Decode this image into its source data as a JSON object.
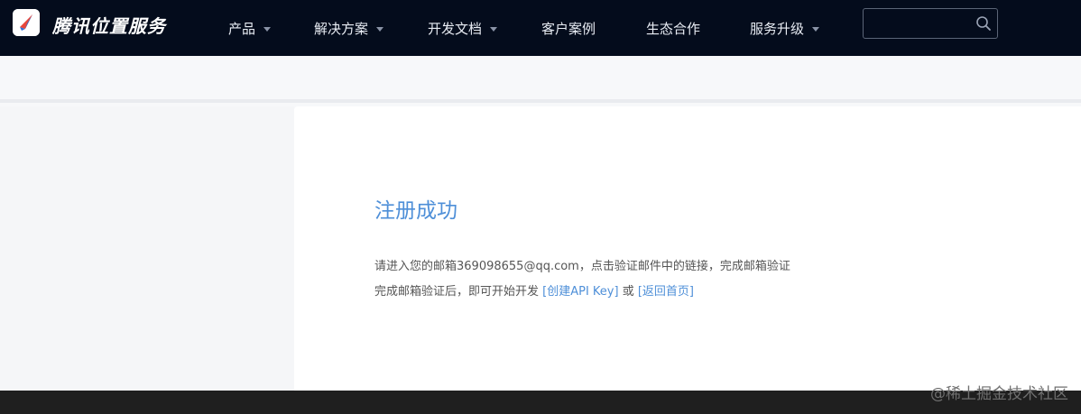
{
  "header": {
    "brand": "腾讯位置服务",
    "nav": [
      {
        "label": "产品",
        "has_dropdown": true
      },
      {
        "label": "解决方案",
        "has_dropdown": true
      },
      {
        "label": "开发文档",
        "has_dropdown": true
      },
      {
        "label": "客户案例",
        "has_dropdown": false
      },
      {
        "label": "生态合作",
        "has_dropdown": false
      },
      {
        "label": "服务升级",
        "has_dropdown": true
      }
    ],
    "search": {
      "value": "",
      "placeholder": "",
      "icon": "search-icon"
    }
  },
  "main": {
    "title": "注册成功",
    "line1": "请进入您的邮箱369098655@qq.com，点击验证邮件中的链接，完成邮箱验证",
    "line2_prefix": "完成邮箱验证后，即可开始开发 ",
    "link_create_key": "[创建API Key]",
    "line2_or": " 或 ",
    "link_back_home": "[返回首页]"
  },
  "watermark": "@稀土掘金技术社区",
  "colors": {
    "nav_bg": "#040c1c",
    "accent": "#4e8fd8",
    "body_bg": "#f7f8fa",
    "card_bg": "#ffffff",
    "bottom_bar": "#1f1f1f"
  }
}
